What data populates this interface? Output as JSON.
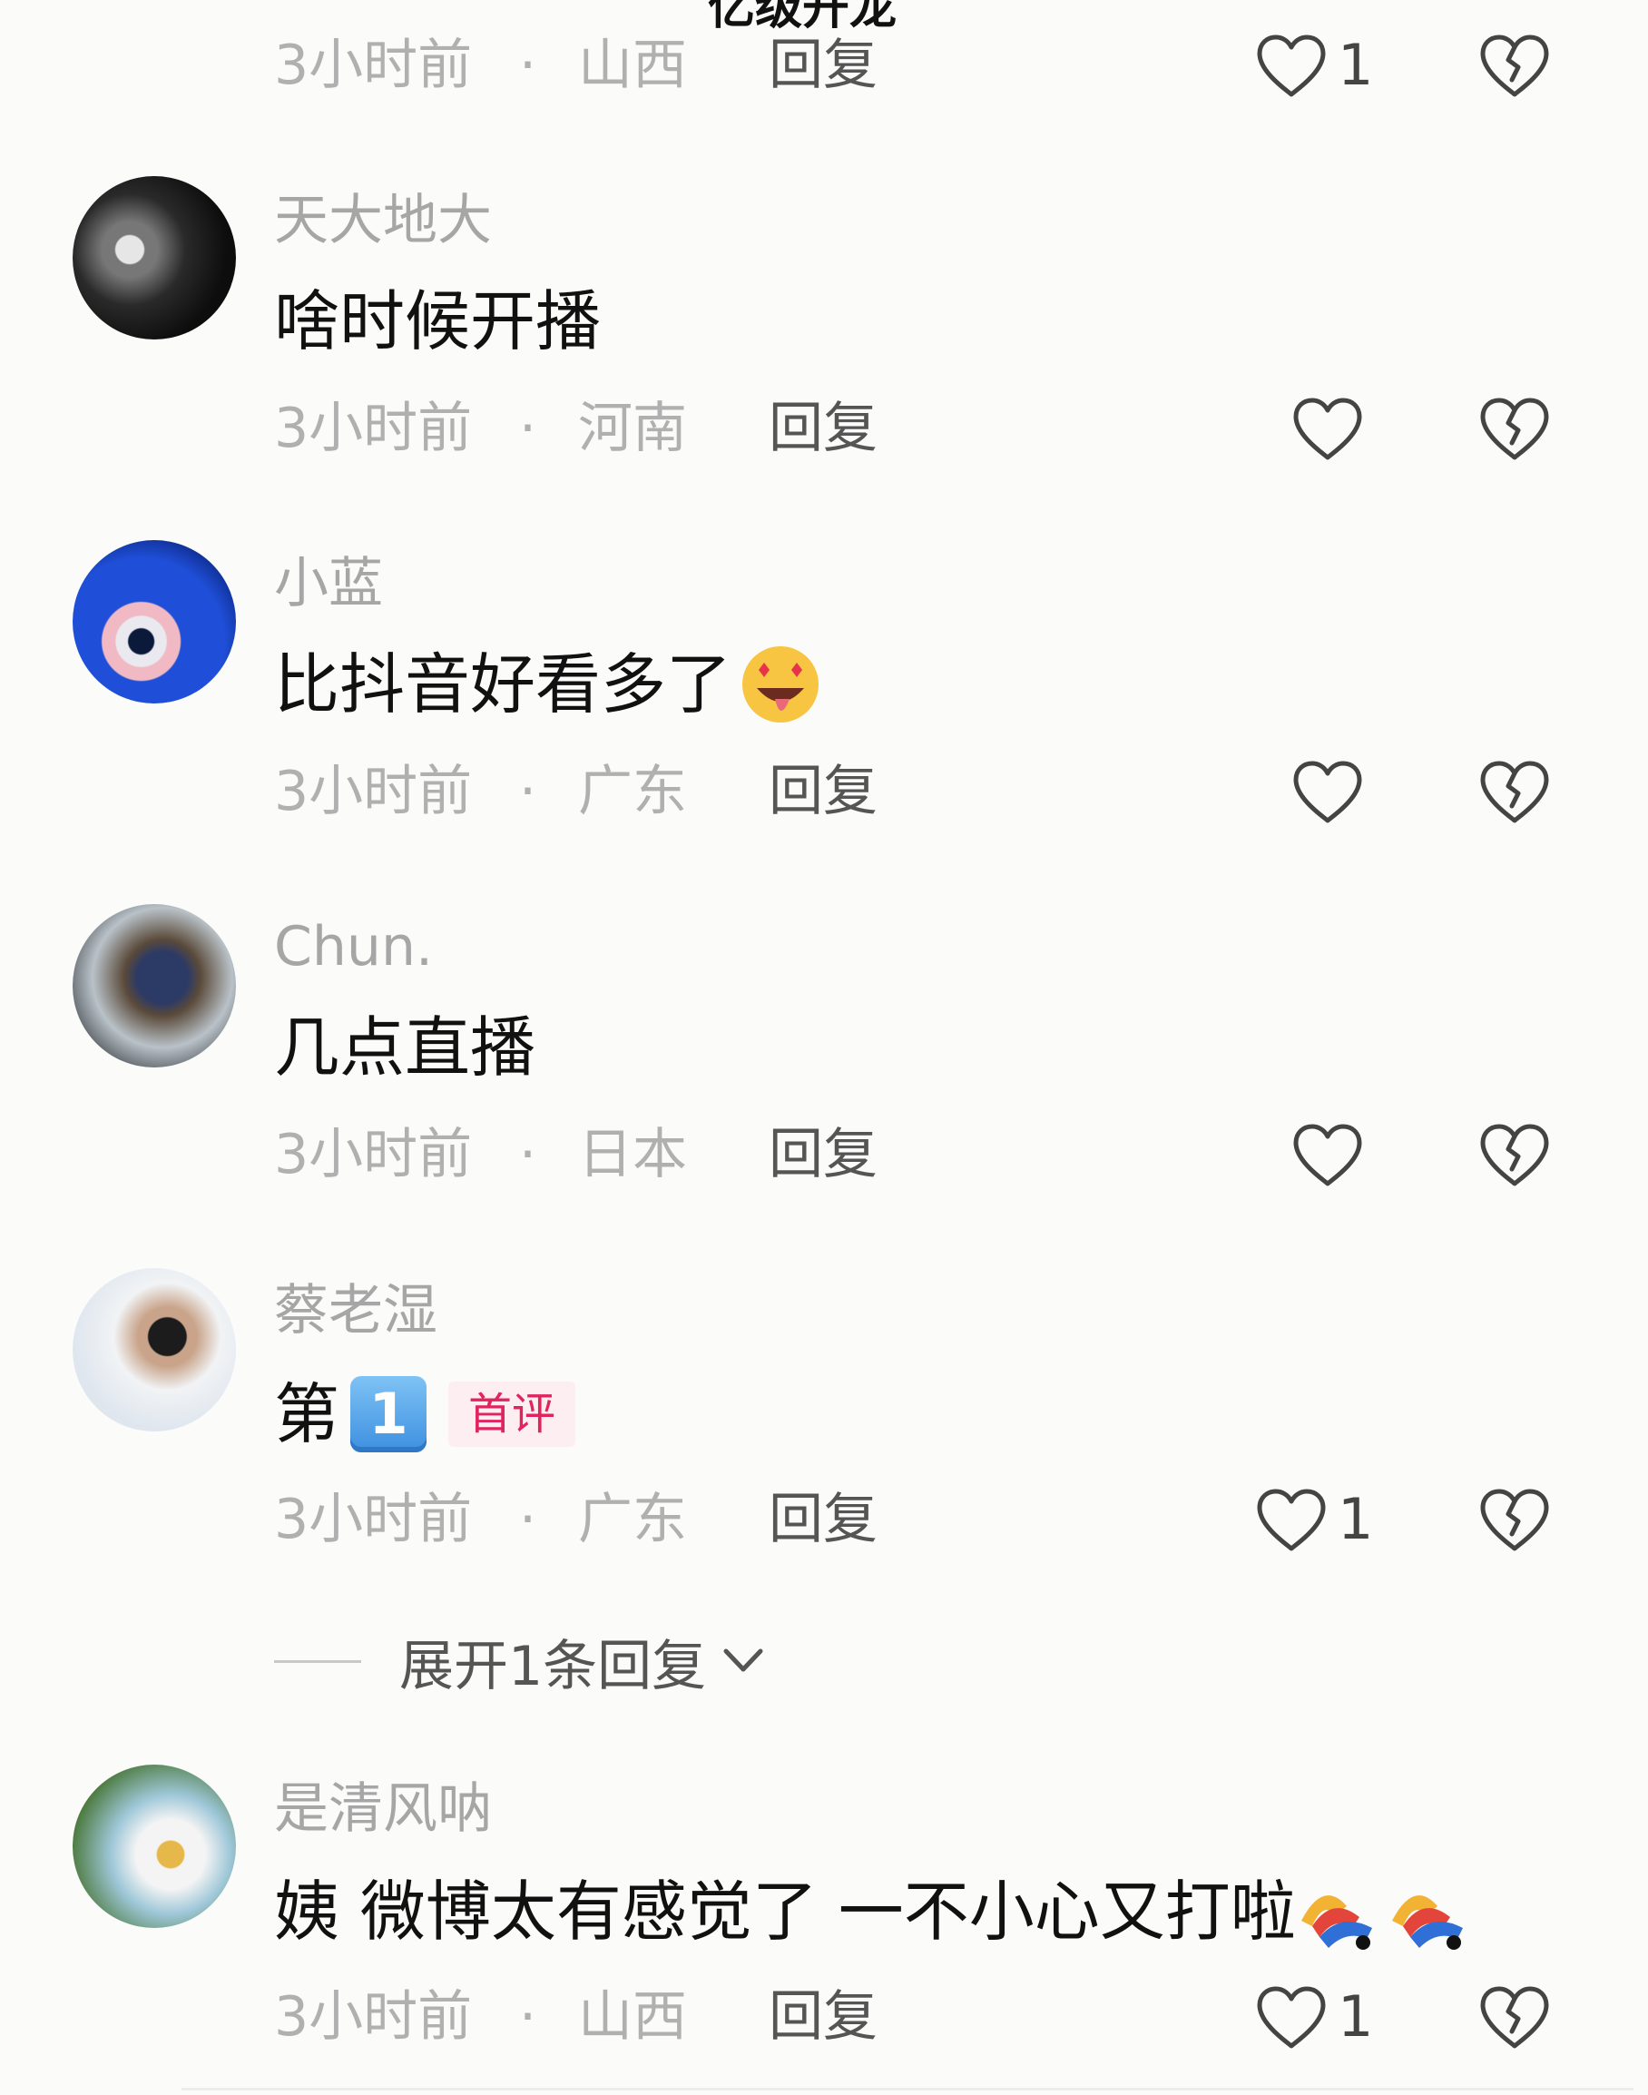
{
  "top_cut_text": "亿级开龙",
  "reply_label": "回复",
  "dot": "·",
  "comments": [
    {
      "time": "3小时前",
      "location": "山西",
      "likes": "1"
    },
    {
      "username": "天大地大",
      "text": "啥时候开播",
      "time": "3小时前",
      "location": "河南",
      "likes": ""
    },
    {
      "username": "小蓝",
      "text": "比抖音好看多了",
      "emoji": "star-struck-tongue-emoji",
      "time": "3小时前",
      "location": "广东",
      "likes": ""
    },
    {
      "username": "Chun.",
      "text": "几点直播",
      "time": "3小时前",
      "location": "日本",
      "likes": ""
    },
    {
      "username": "蔡老湿",
      "text": "第",
      "keycap": "1",
      "badge": "首评",
      "time": "3小时前",
      "location": "广东",
      "likes": "1"
    },
    {
      "username": "是清风呐",
      "text": "姨  微博太有感觉了 一不小心又打啦",
      "emoji": "dancing-emoji",
      "time": "3小时前",
      "location": "山西",
      "likes": "1"
    }
  ],
  "expand_replies": "展开1条回复",
  "colors": {
    "accent_red": "#e0245e",
    "text_muted": "#b0b0b0"
  }
}
